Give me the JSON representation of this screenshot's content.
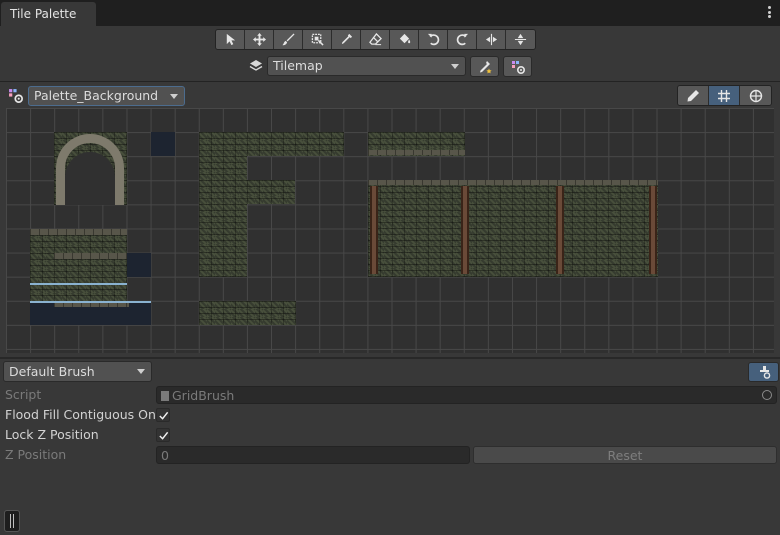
{
  "tab": {
    "title": "Tile Palette"
  },
  "toolbar": {
    "tools": [
      "select-icon",
      "move-icon",
      "paintbrush-icon",
      "box-fill-icon",
      "picker-icon",
      "eraser-icon",
      "flood-fill-icon",
      "rotate-ccw-icon",
      "rotate-cw-icon",
      "flip-x-icon",
      "flip-y-icon"
    ]
  },
  "target": {
    "label": "Tilemap",
    "icon": "layers-icon"
  },
  "palette": {
    "label": "Palette_Background",
    "icon": "palette-icon",
    "view_modes": [
      "pencil-icon",
      "grid-icon",
      "gizmo-icon"
    ],
    "active_mode": "grid-icon"
  },
  "brush": {
    "label": "Default Brush"
  },
  "properties": {
    "script_label": "Script",
    "script_value": "GridBrush",
    "flood_label": "Flood Fill Contiguous Only",
    "flood_checked": true,
    "lockz_label": "Lock Z Position",
    "lockz_checked": true,
    "zpos_label": "Z Position",
    "zpos_value": "0",
    "reset_label": "Reset"
  },
  "colors": {
    "accent": "#46607c",
    "panel": "#383838",
    "canvas": "#303030"
  }
}
